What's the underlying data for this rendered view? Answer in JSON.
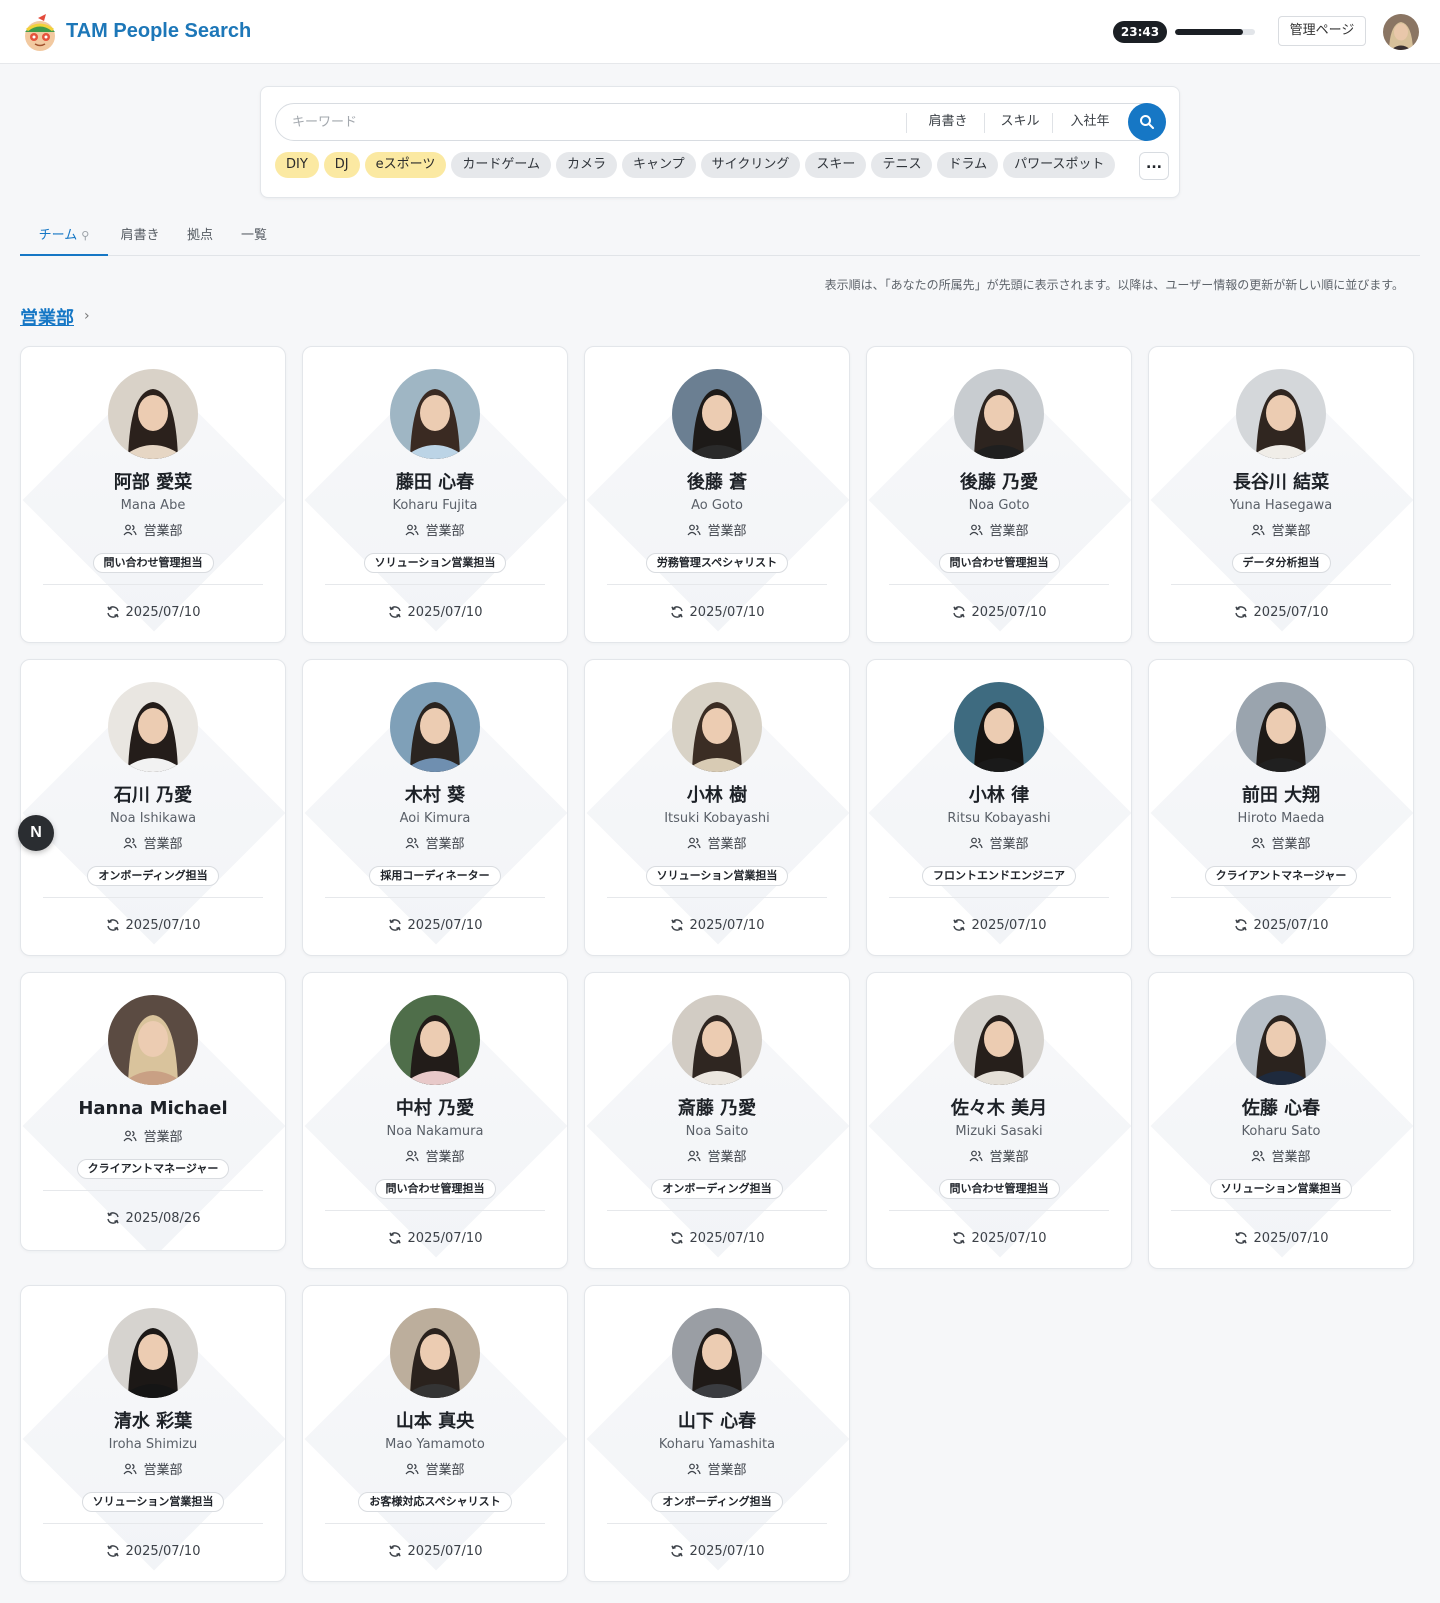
{
  "header": {
    "app_title": "TAM People Search",
    "timer": "23:43",
    "timer_progress": 0.85,
    "admin_label": "管理ページ"
  },
  "search": {
    "placeholder": "キーワード",
    "filters": [
      "肩書き",
      "スキル",
      "入社年"
    ],
    "tags": [
      {
        "label": "DIY",
        "active": true
      },
      {
        "label": "DJ",
        "active": true
      },
      {
        "label": "eスポーツ",
        "active": true
      },
      {
        "label": "カードゲーム",
        "active": false
      },
      {
        "label": "カメラ",
        "active": false
      },
      {
        "label": "キャンプ",
        "active": false
      },
      {
        "label": "サイクリング",
        "active": false
      },
      {
        "label": "スキー",
        "active": false
      },
      {
        "label": "テニス",
        "active": false
      },
      {
        "label": "ドラム",
        "active": false
      },
      {
        "label": "パワースポット",
        "active": false
      }
    ],
    "more_label": "..."
  },
  "tabs": [
    {
      "label": "チーム",
      "active": true,
      "pinned": true
    },
    {
      "label": "肩書き",
      "active": false
    },
    {
      "label": "拠点",
      "active": false
    },
    {
      "label": "一覧",
      "active": false
    }
  ],
  "sort_note": "表示順は、「あなたの所属先」が先頭に表示されます。以降は、ユーザー情報の更新が新しい順に並びます。",
  "section": {
    "title": "営業部",
    "chevron": "›"
  },
  "colors": {
    "accent": "#1677c5",
    "tag_active": "#fbe9a2",
    "title_blue": "#1d77b8"
  },
  "people": [
    {
      "name_jp": "阿部 愛菜",
      "name_en": "Mana Abe",
      "dept": "営業部",
      "role": "問い合わせ管理担当",
      "updated": "2025/07/10"
    },
    {
      "name_jp": "藤田 心春",
      "name_en": "Koharu Fujita",
      "dept": "営業部",
      "role": "ソリューション営業担当",
      "updated": "2025/07/10"
    },
    {
      "name_jp": "後藤 蒼",
      "name_en": "Ao Goto",
      "dept": "営業部",
      "role": "労務管理スペシャリスト",
      "updated": "2025/07/10"
    },
    {
      "name_jp": "後藤 乃愛",
      "name_en": "Noa Goto",
      "dept": "営業部",
      "role": "問い合わせ管理担当",
      "updated": "2025/07/10"
    },
    {
      "name_jp": "長谷川 結菜",
      "name_en": "Yuna Hasegawa",
      "dept": "営業部",
      "role": "データ分析担当",
      "updated": "2025/07/10"
    },
    {
      "name_jp": "石川 乃愛",
      "name_en": "Noa Ishikawa",
      "dept": "営業部",
      "role": "オンボーディング担当",
      "updated": "2025/07/10"
    },
    {
      "name_jp": "木村 葵",
      "name_en": "Aoi Kimura",
      "dept": "営業部",
      "role": "採用コーディネーター",
      "updated": "2025/07/10"
    },
    {
      "name_jp": "小林 樹",
      "name_en": "Itsuki Kobayashi",
      "dept": "営業部",
      "role": "ソリューション営業担当",
      "updated": "2025/07/10"
    },
    {
      "name_jp": "小林 律",
      "name_en": "Ritsu Kobayashi",
      "dept": "営業部",
      "role": "フロントエンドエンジニア",
      "updated": "2025/07/10"
    },
    {
      "name_jp": "前田 大翔",
      "name_en": "Hiroto Maeda",
      "dept": "営業部",
      "role": "クライアントマネージャー",
      "updated": "2025/07/10"
    },
    {
      "name_jp": "Hanna Michael",
      "name_en": "",
      "dept": "営業部",
      "role": "クライアントマネージャー",
      "updated": "2025/08/26"
    },
    {
      "name_jp": "中村 乃愛",
      "name_en": "Noa Nakamura",
      "dept": "営業部",
      "role": "問い合わせ管理担当",
      "updated": "2025/07/10"
    },
    {
      "name_jp": "斎藤 乃愛",
      "name_en": "Noa Saito",
      "dept": "営業部",
      "role": "オンボーディング担当",
      "updated": "2025/07/10"
    },
    {
      "name_jp": "佐々木 美月",
      "name_en": "Mizuki Sasaki",
      "dept": "営業部",
      "role": "問い合わせ管理担当",
      "updated": "2025/07/10"
    },
    {
      "name_jp": "佐藤 心春",
      "name_en": "Koharu Sato",
      "dept": "営業部",
      "role": "ソリューション営業担当",
      "updated": "2025/07/10"
    },
    {
      "name_jp": "清水 彩葉",
      "name_en": "Iroha Shimizu",
      "dept": "営業部",
      "role": "ソリューション営業担当",
      "updated": "2025/07/10"
    },
    {
      "name_jp": "山本 真央",
      "name_en": "Mao Yamamoto",
      "dept": "営業部",
      "role": "お客様対応スペシャリスト",
      "updated": "2025/07/10"
    },
    {
      "name_jp": "山下 心春",
      "name_en": "Koharu Yamashita",
      "dept": "営業部",
      "role": "オンボーディング担当",
      "updated": "2025/07/10"
    }
  ],
  "fab_label": "N"
}
